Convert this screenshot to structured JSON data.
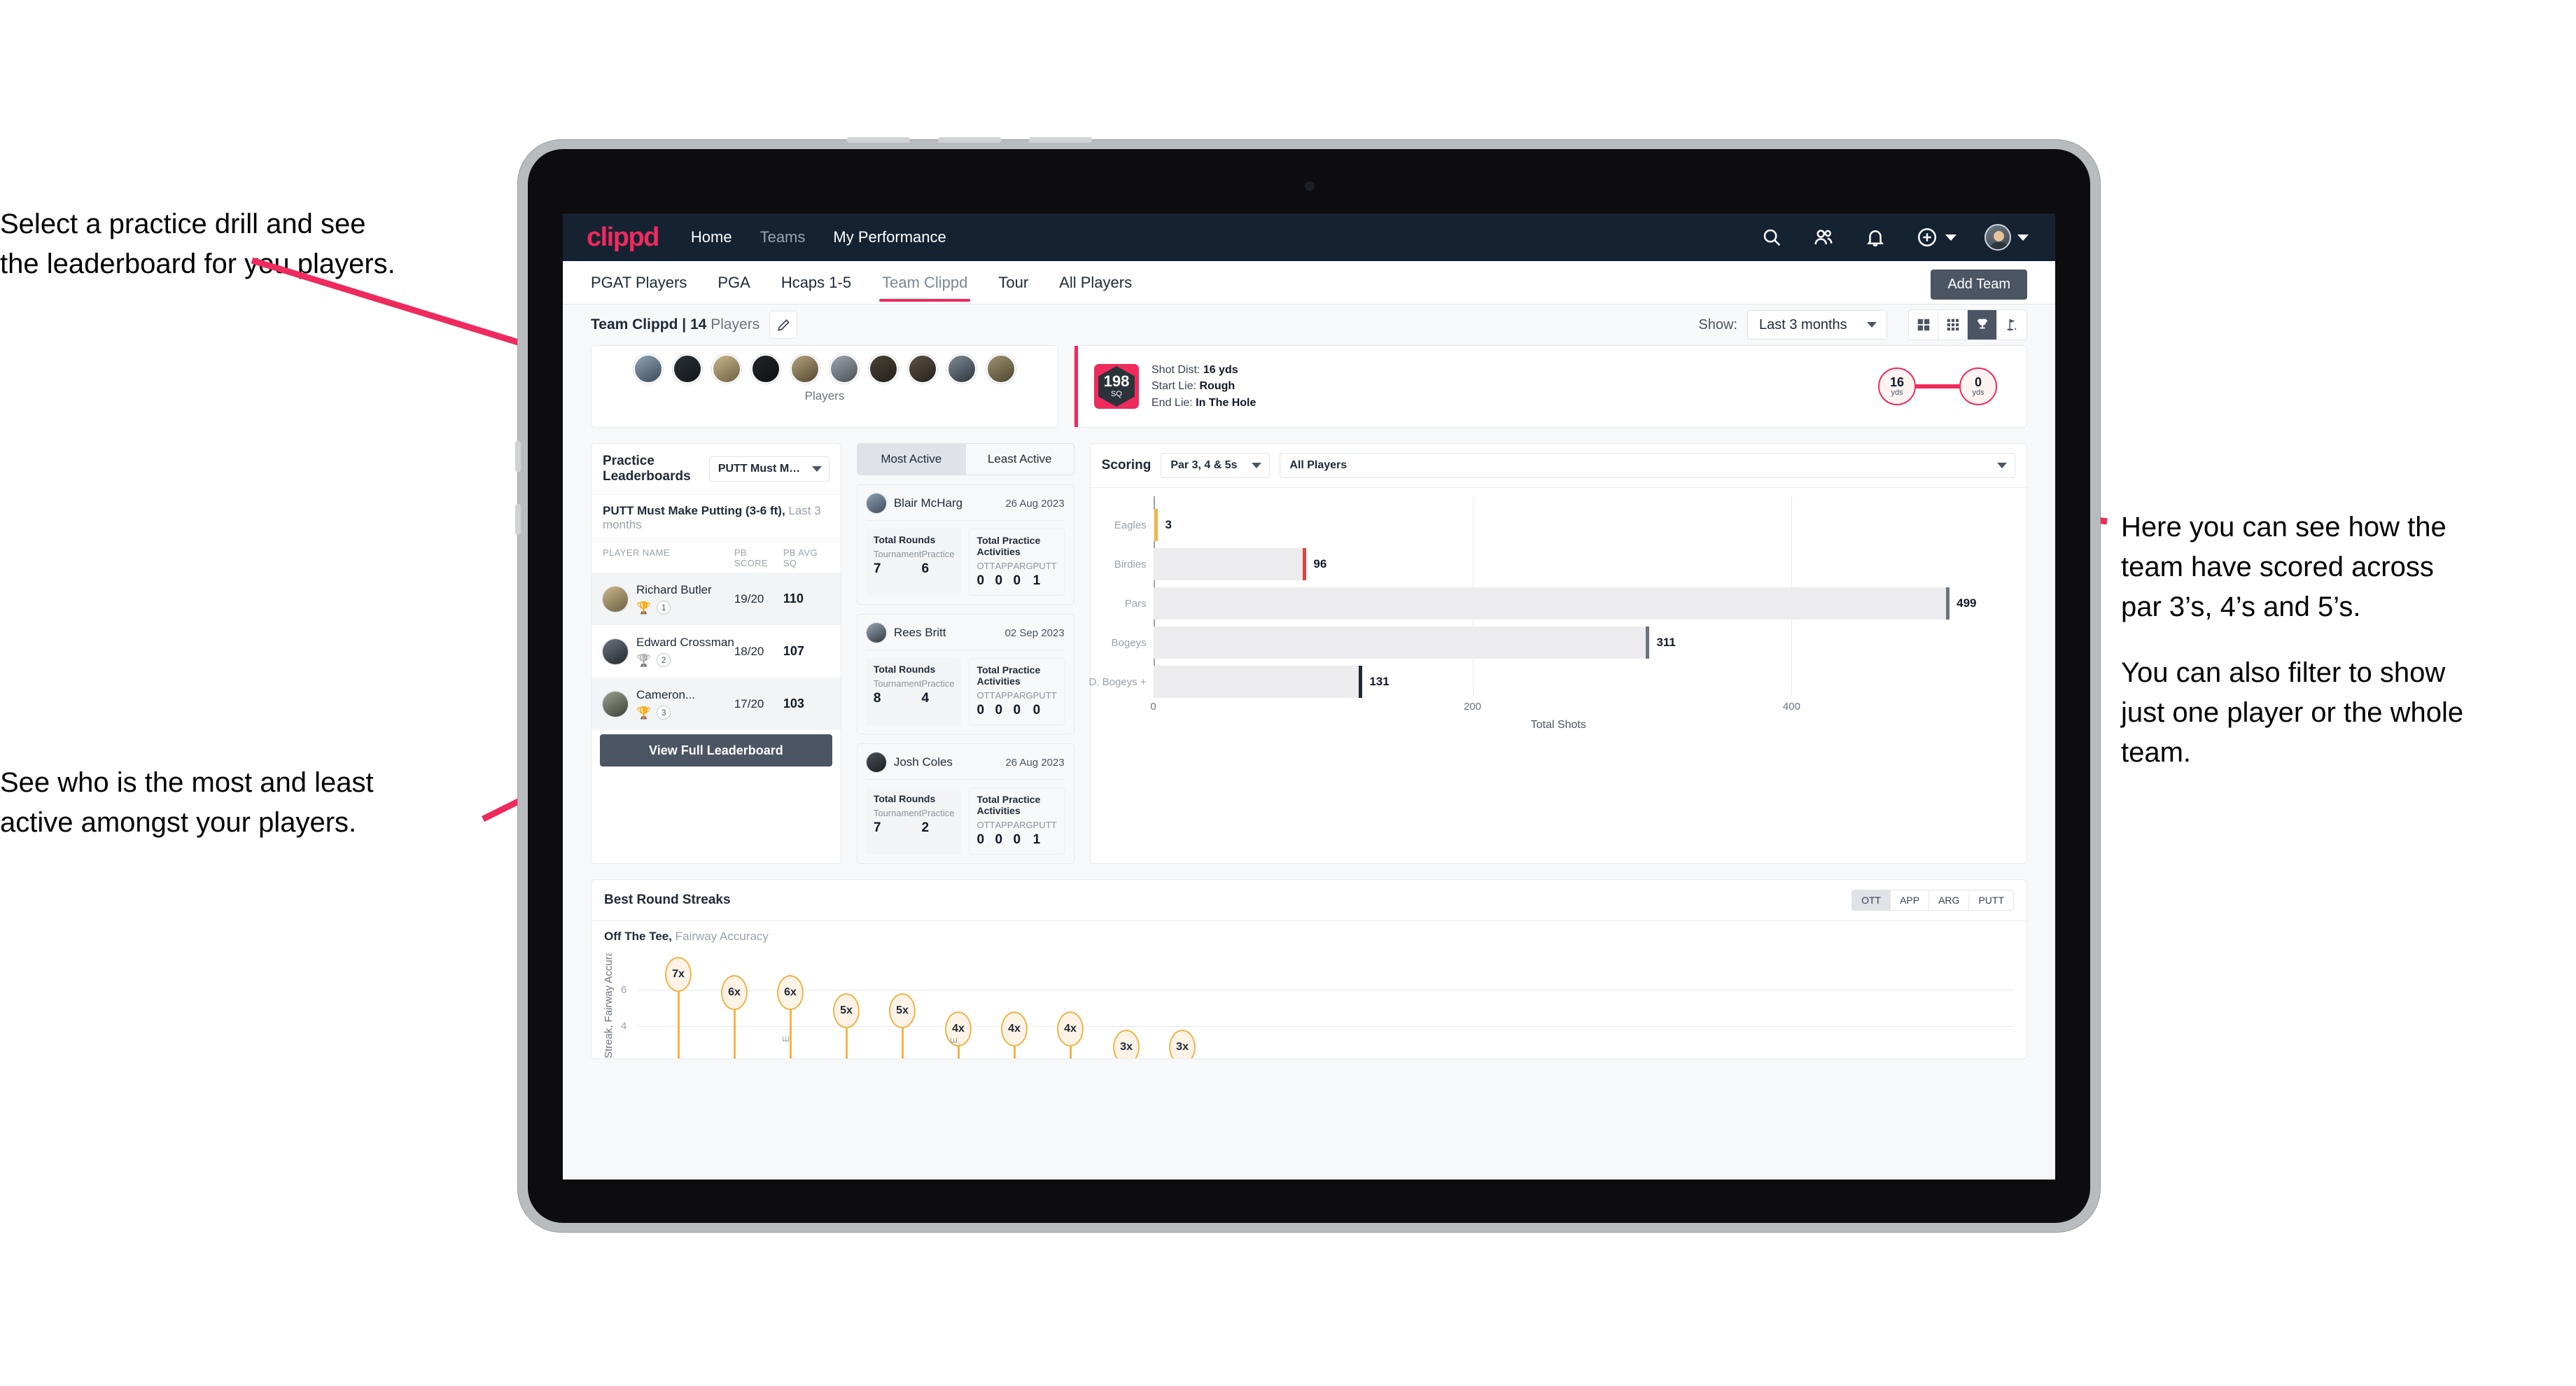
{
  "annotations": {
    "top_left": [
      "Select a practice drill and see",
      "the leaderboard for you players."
    ],
    "bottom_left": [
      "See who is the most and least",
      "active amongst your players."
    ],
    "right_1": [
      "Here you can see how the",
      "team have scored across",
      "par 3’s, 4’s and 5’s."
    ],
    "right_2": [
      "You can also filter to show",
      "just one player or the whole",
      "team."
    ]
  },
  "navbar": {
    "logo": "clippd",
    "links": [
      {
        "label": "Home",
        "active": true
      },
      {
        "label": "Teams",
        "active": false
      },
      {
        "label": "My Performance",
        "active": true
      }
    ],
    "icons": [
      "search-icon",
      "people-icon",
      "bell-icon",
      "plus-circle-icon",
      "avatar"
    ]
  },
  "subtabs": {
    "items": [
      "PGAT Players",
      "PGA",
      "Hcaps 1-5",
      "Team Clippd",
      "Tour",
      "All Players"
    ],
    "active": "Team Clippd",
    "add_team_label": "Add Team"
  },
  "teambar": {
    "team_label_bold": "Team Clippd | 14",
    "team_label_muted": " Players",
    "edit_icon": "pencil-icon",
    "show_label": "Show:",
    "period_value": "Last 3 months",
    "view_modes": [
      "grid-2x2-icon",
      "grid-3x3-icon",
      "trophy-icon",
      "flag-icon"
    ],
    "view_active_index": 2
  },
  "players_card": {
    "caption": "Players",
    "avatar_count": 10
  },
  "shot_card": {
    "sq_value": "198",
    "sq_unit": "SQ",
    "lines": [
      {
        "key": "Shot Dist:",
        "value": "16 yds"
      },
      {
        "key": "Start Lie:",
        "value": "Rough"
      },
      {
        "key": "End Lie:",
        "value": "In The Hole"
      }
    ],
    "start_dist": "16",
    "start_unit": "yds",
    "end_dist": "0",
    "end_unit": "yds"
  },
  "leaderboard": {
    "title": "Practice Leaderboards",
    "drill_select": "PUTT Must Make Putting ...",
    "subtitle_bold": "PUTT Must Make Putting (3-6 ft),",
    "subtitle_muted": " Last 3 months",
    "columns": [
      "PLAYER NAME",
      "PB SCORE",
      "PB AVG SQ"
    ],
    "rows": [
      {
        "name": "Richard Butler",
        "rank": "1",
        "trophy": "gold",
        "score": "19/20",
        "avg": "110"
      },
      {
        "name": "Edward Crossman",
        "rank": "2",
        "trophy": "silver",
        "score": "18/20",
        "avg": "107"
      },
      {
        "name": "Cameron...",
        "rank": "3",
        "trophy": "bronze",
        "score": "17/20",
        "avg": "103"
      }
    ],
    "cta": "View Full Leaderboard"
  },
  "activity": {
    "tabs": [
      "Most Active",
      "Least Active"
    ],
    "active_tab": "Most Active",
    "rounds_title": "Total Rounds",
    "rounds_keys": [
      "Tournament",
      "Practice"
    ],
    "practice_title": "Total Practice Activities",
    "practice_keys": [
      "OTT",
      "APP",
      "ARG",
      "PUTT"
    ],
    "cards": [
      {
        "name": "Blair McHarg",
        "date": "26 Aug 2023",
        "rounds": [
          "7",
          "6"
        ],
        "practice": [
          "0",
          "0",
          "0",
          "1"
        ]
      },
      {
        "name": "Rees Britt",
        "date": "02 Sep 2023",
        "rounds": [
          "8",
          "4"
        ],
        "practice": [
          "0",
          "0",
          "0",
          "0"
        ]
      },
      {
        "name": "Josh Coles",
        "date": "26 Aug 2023",
        "rounds": [
          "7",
          "2"
        ],
        "practice": [
          "0",
          "0",
          "0",
          "1"
        ]
      }
    ]
  },
  "scoring": {
    "title": "Scoring",
    "par_select": "Par 3, 4 & 5s",
    "player_select": "All Players"
  },
  "streaks": {
    "title": "Best Round Streaks",
    "toggle": [
      "OTT",
      "APP",
      "ARG",
      "PUTT"
    ],
    "toggle_active": "OTT",
    "subtitle_bold": "Off The Tee,",
    "subtitle_muted": " Fairway Accuracy"
  },
  "chart_data": [
    {
      "type": "bar",
      "orientation": "horizontal",
      "title": "Scoring",
      "categories": [
        "Eagles",
        "Birdies",
        "Pars",
        "Bogeys",
        "D. Bogeys +"
      ],
      "values": [
        3,
        96,
        499,
        311,
        131
      ],
      "cap_colors": [
        "#f0b44a",
        "#e8433a",
        "#6b7280",
        "#6b7280",
        "#1f2937"
      ],
      "xlabel": "Total Shots",
      "ylabel": "",
      "xlim": [
        0,
        520
      ],
      "xticks": [
        0,
        200,
        400
      ],
      "grid": true,
      "legend": "none"
    },
    {
      "type": "scatter",
      "title": "Best Round Streaks",
      "subtitle": "Off The Tee, Fairway Accuracy",
      "ylabel": "Streak, Fairway Accuracy",
      "yticks": [
        4,
        6
      ],
      "ylim": [
        2.2,
        7.8
      ],
      "labels": [
        "7x",
        "6x",
        "6x",
        "5x",
        "5x",
        "4x",
        "4x",
        "4x",
        "3x",
        "3x"
      ],
      "values": [
        7,
        6,
        6,
        5,
        5,
        4,
        4,
        4,
        3,
        3
      ],
      "grid": true,
      "legend": "none"
    }
  ]
}
